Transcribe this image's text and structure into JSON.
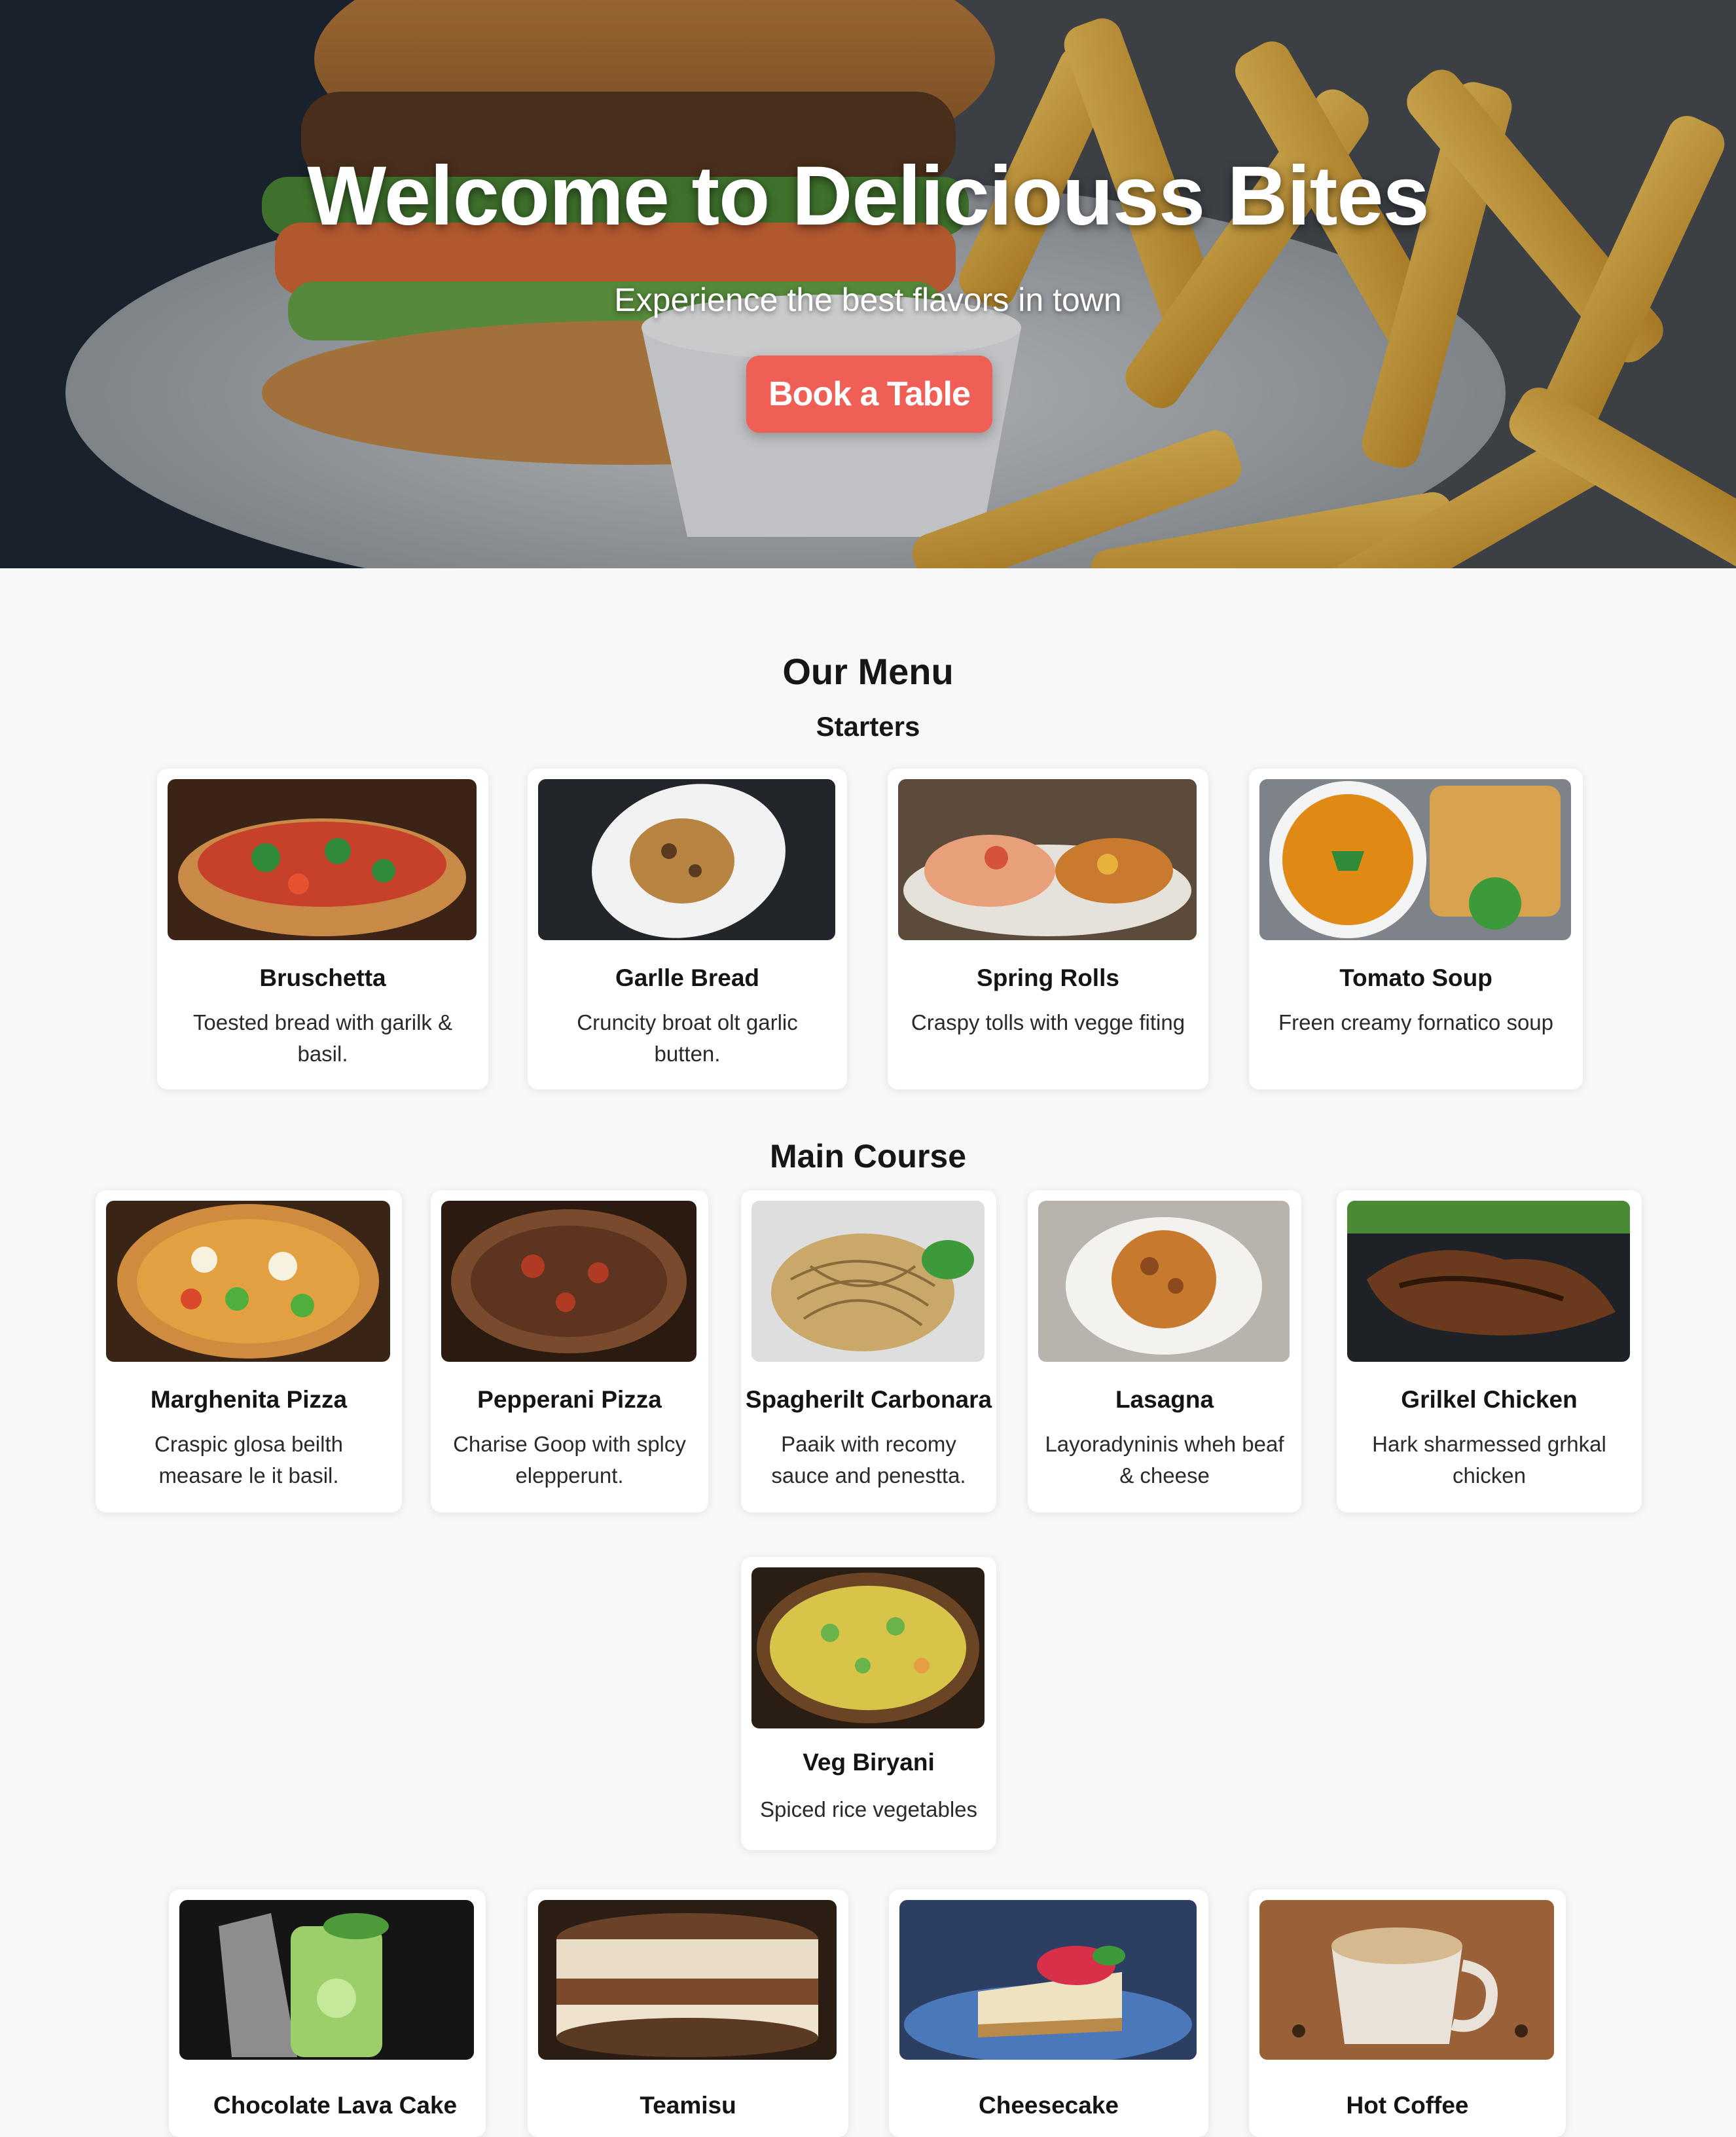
{
  "hero": {
    "title": "Welcome to Deliciouss Bites",
    "subtitle": "Experience the best flavors in town",
    "button_label": "Book a Table",
    "accent_color": "#ef5f55"
  },
  "menu": {
    "title": "Our Menu",
    "sections": [
      {
        "title": "Starters",
        "items": [
          {
            "name": "Bruschetta",
            "description": "Toested bread with garilk & basil."
          },
          {
            "name": "Garlle Bread",
            "description": "Cruncity broat olt garlic butten."
          },
          {
            "name": "Spring Rolls",
            "description": "Craspy tolls with vegge fiting"
          },
          {
            "name": "Tomato Soup",
            "description": "Freen creamy fornatico soup"
          }
        ]
      },
      {
        "title": "Main Course",
        "items": [
          {
            "name": "Marghenita Pizza",
            "description": "Craspic glosa beilth measare le it basil."
          },
          {
            "name": "Pepperani Pizza",
            "description": "Charise  Goop with splcy elepperunt."
          },
          {
            "name": "Spagherilt Carbonara",
            "description": "Paaik with recomy sauce and penestta."
          },
          {
            "name": "Lasagna",
            "description": "Layoradyninis wheh beaf & cheese"
          },
          {
            "name": "Grilkel Chicken",
            "description": "Hark sharmessed grhkal chicken"
          },
          {
            "name": "Veg Biryani",
            "description": "Spiced rice vegetables"
          }
        ]
      },
      {
        "title": "",
        "items": [
          {
            "name": "Chocolate Lava Cake",
            "description": ""
          },
          {
            "name": "Teamisu",
            "description": ""
          },
          {
            "name": "Cheesecake",
            "description": ""
          },
          {
            "name": "Hot Coffee",
            "description": ""
          }
        ]
      }
    ]
  }
}
